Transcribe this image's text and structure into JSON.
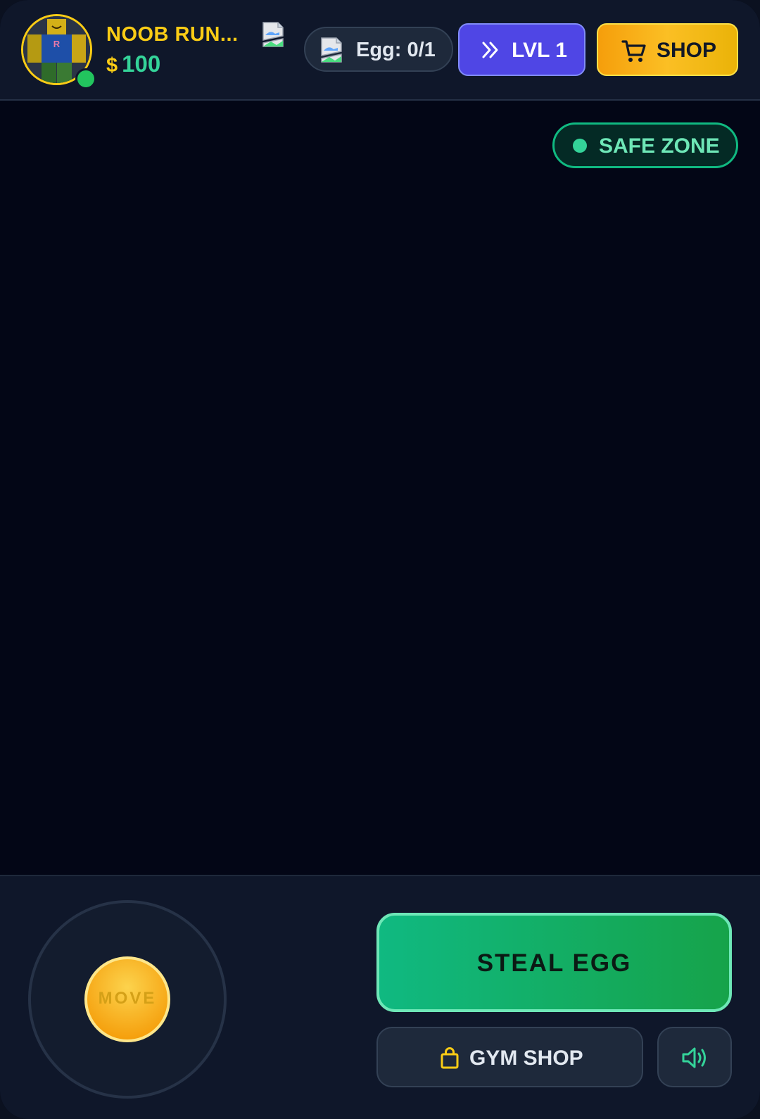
{
  "player": {
    "name": "NOOB RUN...",
    "currency_symbol": "$",
    "money": "100",
    "status": "online"
  },
  "hud": {
    "egg_counter": "Egg: 0/1",
    "level_button": "LVL 1",
    "shop_button": "SHOP"
  },
  "zone": {
    "label": "SAFE ZONE"
  },
  "controls": {
    "joystick_label": "MOVE",
    "steal_button": "STEAL EGG",
    "gym_shop_button": "GYM SHOP"
  },
  "icons": {
    "avatar": "noob-avatar-icon",
    "broken_image": "broken-image-icon",
    "level": "chevrons-right-icon",
    "shop": "cart-icon",
    "gym_shop": "shopping-bag-icon",
    "sound": "volume-icon"
  },
  "colors": {
    "accent_gold": "#facc15",
    "money_green": "#34d399",
    "level_purple": "#4f46e5",
    "shop_orange": "#f59e0b",
    "safe_zone_green": "#10b981",
    "steal_green": "#16a34a"
  }
}
